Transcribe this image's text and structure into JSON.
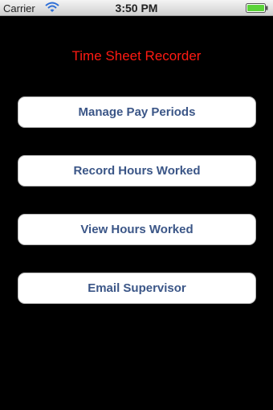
{
  "status_bar": {
    "carrier": "Carrier",
    "time": "3:50 PM",
    "wifi_icon": "wifi-icon",
    "battery_icon": "battery-icon",
    "battery_level": 1.0,
    "battery_color": "#5bd33a"
  },
  "app": {
    "title": "Time Sheet Recorder",
    "title_color": "#ff1a12"
  },
  "menu": {
    "manage_pay_periods": "Manage Pay Periods",
    "record_hours_worked": "Record Hours Worked",
    "view_hours_worked": "View Hours Worked",
    "email_supervisor": "Email Supervisor",
    "label_color": "#3b5687"
  }
}
